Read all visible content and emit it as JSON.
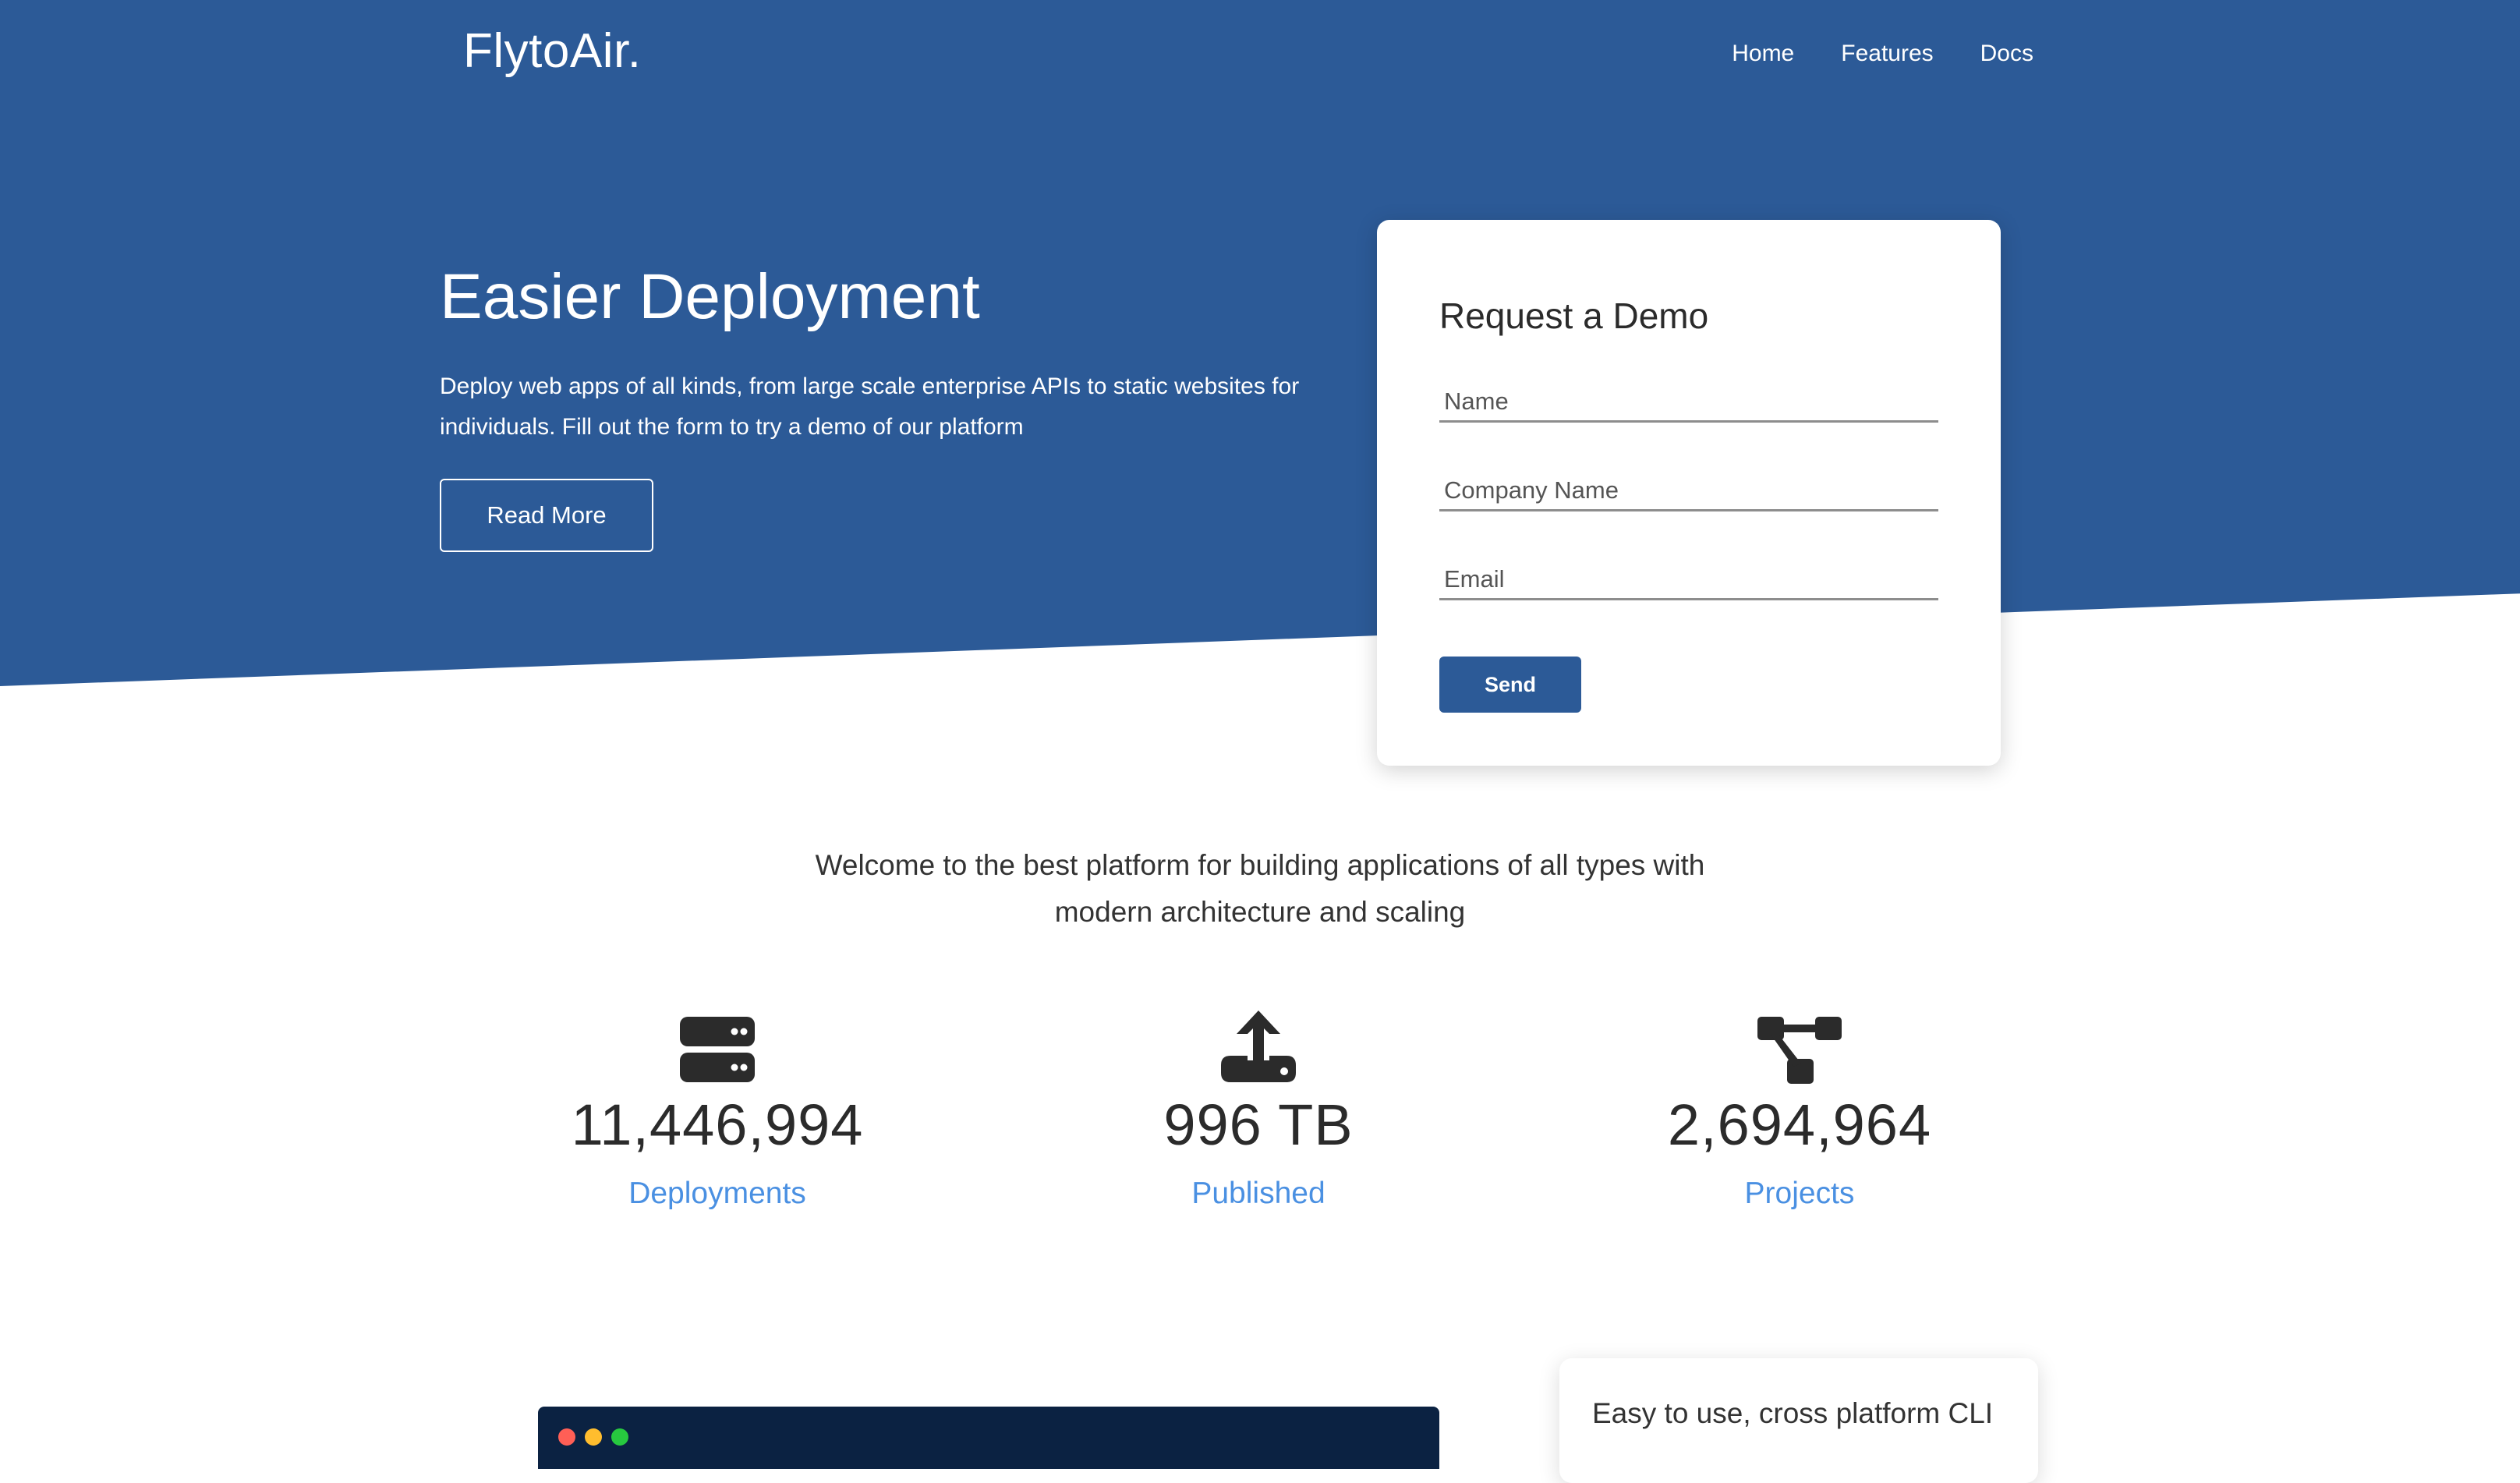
{
  "brand": "FlytoAir.",
  "nav": {
    "items": [
      "Home",
      "Features",
      "Docs"
    ]
  },
  "hero": {
    "title": "Easier Deployment",
    "text": "Deploy web apps of all kinds, from large scale enterprise APIs to static websites for individuals. Fill out the form to try a demo of our platform",
    "button_label": "Read More"
  },
  "demo_form": {
    "title": "Request a Demo",
    "name_placeholder": "Name",
    "company_placeholder": "Company Name",
    "email_placeholder": "Email",
    "send_label": "Send"
  },
  "welcome": "Welcome to the best platform for building applications of all types with modern architecture and scaling",
  "stats": [
    {
      "icon": "server-icon",
      "value": "11,446,994",
      "label": "Deployments"
    },
    {
      "icon": "upload-icon",
      "value": "996 TB",
      "label": "Published"
    },
    {
      "icon": "project-tree-icon",
      "value": "2,694,964",
      "label": "Projects"
    }
  ],
  "cli_card": {
    "text": "Easy to use, cross platform CLI"
  },
  "colors": {
    "hero_blue": "#2c5a97",
    "accent_link": "#4a90e2",
    "terminal_bg": "#0b2242",
    "dot_red": "#ff5f56",
    "dot_yellow": "#ffbd2e",
    "dot_green": "#27c93f"
  }
}
